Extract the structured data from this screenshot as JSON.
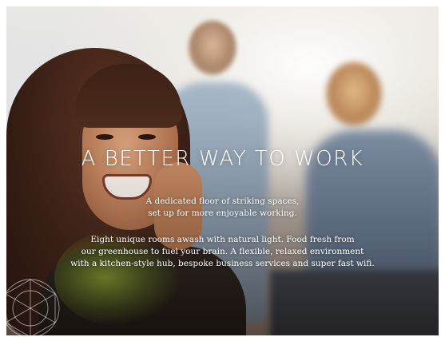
{
  "hero": {
    "headline": "A BETTER WAY TO WORK",
    "intro_lines": [
      "A dedicated floor of striking spaces,",
      "set up for more enjoyable working."
    ],
    "body_lines": [
      "Eight unique rooms awash with natural light. Food fresh from",
      "our greenhouse to fuel your brain. A flexible, relaxed environment",
      "with a kitchen-style hub, bespoke business services and super fast wifi."
    ],
    "background_icon": "geometric-line-emblem-icon",
    "text_color": "#ffffff"
  }
}
